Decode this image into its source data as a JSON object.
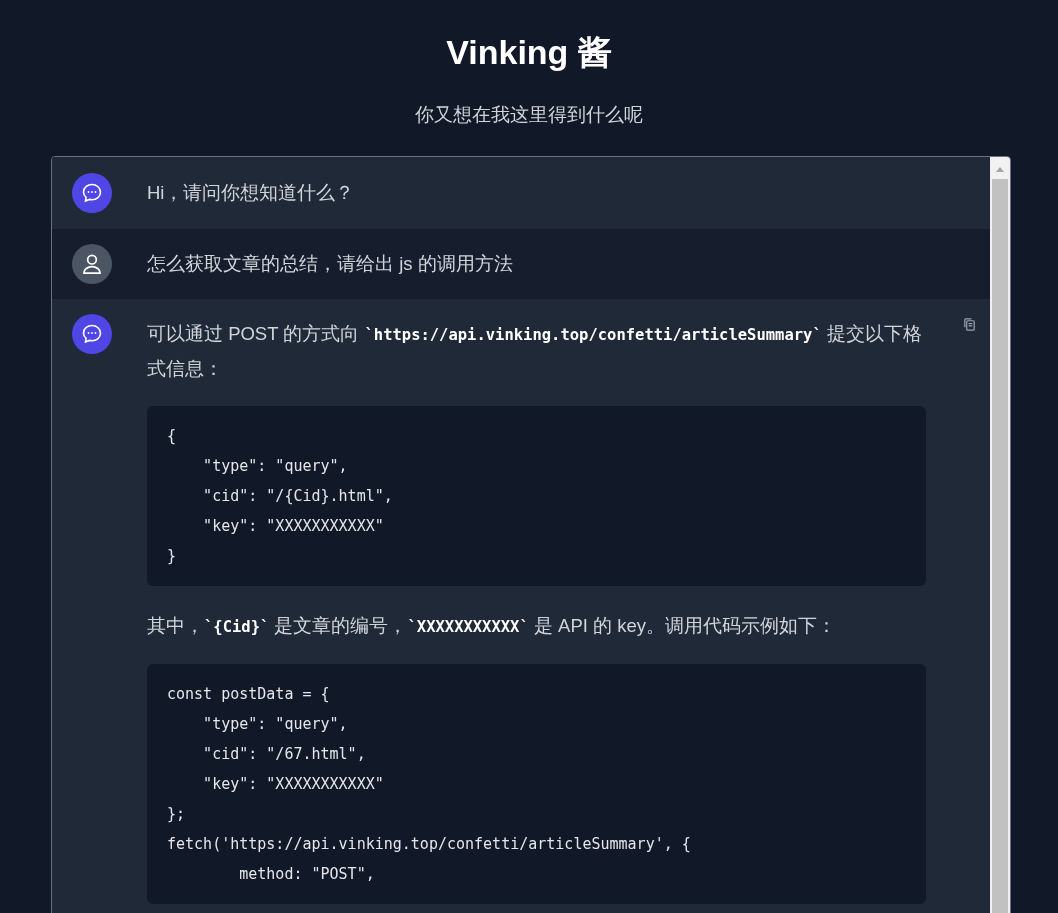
{
  "header": {
    "title": "Vinking 酱",
    "subtitle": "你又想在我这里得到什么呢"
  },
  "messages": [
    {
      "kind": "bot",
      "blocks": [
        {
          "kind": "paragraph",
          "segments": [
            {
              "text": "Hi，请问你想知道什么？",
              "code": false
            }
          ]
        }
      ]
    },
    {
      "kind": "user",
      "blocks": [
        {
          "kind": "paragraph",
          "segments": [
            {
              "text": "怎么获取文章的总结，请给出 js 的调用方法",
              "code": false
            }
          ]
        }
      ]
    },
    {
      "kind": "bot",
      "copy_button": true,
      "blocks": [
        {
          "kind": "paragraph",
          "segments": [
            {
              "text": "可以通过 POST 的方式向 ",
              "code": false
            },
            {
              "text": "`https://api.vinking.top/confetti/articleSummary`",
              "code": true
            },
            {
              "text": " 提交以下格式信息：",
              "code": false
            }
          ]
        },
        {
          "kind": "code",
          "lines": [
            "{",
            "    \"type\": \"query\",",
            "    \"cid\": \"/{Cid}.html\",",
            "    \"key\": \"XXXXXXXXXXX\"",
            "}"
          ]
        },
        {
          "kind": "paragraph",
          "segments": [
            {
              "text": "其中，",
              "code": false
            },
            {
              "text": "`{Cid}`",
              "code": true
            },
            {
              "text": " 是文章的编号，",
              "code": false
            },
            {
              "text": "`XXXXXXXXXXX`",
              "code": true
            },
            {
              "text": " 是 API 的 key。调用代码示例如下：",
              "code": false
            }
          ]
        },
        {
          "kind": "code",
          "lines": [
            "const postData = {",
            "    \"type\": \"query\",",
            "    \"cid\": \"/67.html\",",
            "    \"key\": \"XXXXXXXXXXX\"",
            "};",
            "fetch('https://api.vinking.top/confetti/articleSummary', {",
            "        method: \"POST\","
          ]
        }
      ]
    }
  ]
}
